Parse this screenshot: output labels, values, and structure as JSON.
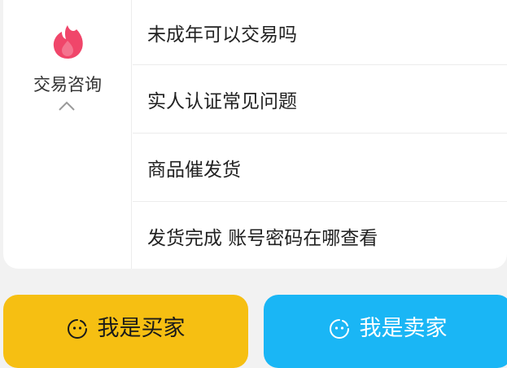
{
  "category": {
    "label": "交易咨询",
    "icon": "flame-icon",
    "icon_color": "#f0466a",
    "expand_icon": "chevron-up-icon"
  },
  "questions": [
    "未成年可以交易吗",
    "实人认证常见问题",
    "商品催发货",
    "发货完成 账号密码在哪查看"
  ],
  "actions": {
    "buyer": {
      "label": "我是买家",
      "icon": "smiley-icon",
      "color": "#f6bf12"
    },
    "seller": {
      "label": "我是卖家",
      "icon": "smiley-icon",
      "color": "#1ab6f5"
    }
  }
}
